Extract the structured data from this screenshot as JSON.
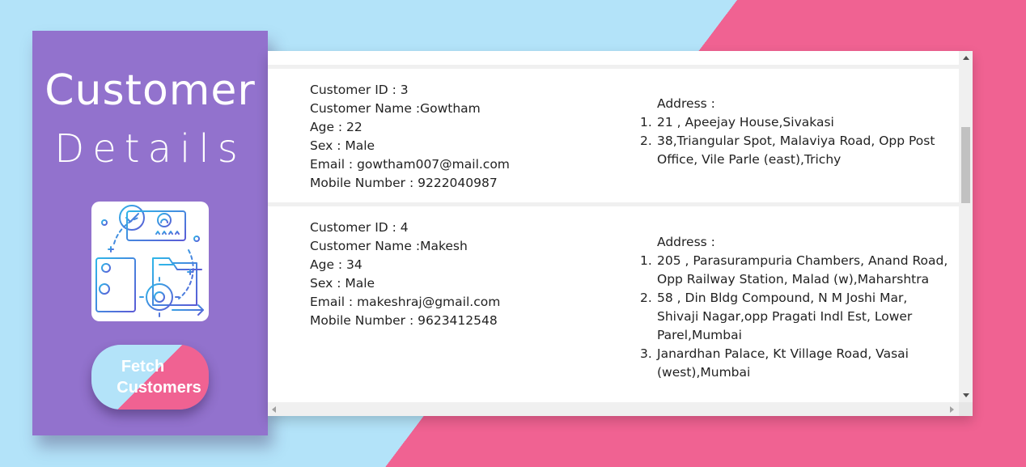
{
  "sidebar": {
    "title_line1": "Customer",
    "title_line2": "Details",
    "illustration_icon": "customer-profile-illustration-icon",
    "fetch_button_line1": "Fetch",
    "fetch_button_line2": "Customers"
  },
  "colors": {
    "sidebar_bg": "#9272cd",
    "background_blue": "#b3e3f9",
    "background_pink": "#f06292",
    "card_bg": "#ffffff",
    "panel_bg": "#f0f0f0"
  },
  "customers": [
    {
      "id_line": "Customer ID : 3",
      "name_line": "Customer Name :Gowtham",
      "age_line": "Age : 22",
      "sex_line": "Sex : Male",
      "email_line": "Email : gowtham007@mail.com",
      "mobile_line": "Mobile Number : 9222040987",
      "address_label": "Address :",
      "addresses": [
        {
          "num": "1.",
          "line1": "21 , Apeejay House,Sivakasi"
        },
        {
          "num": "2.",
          "line1": "38,Triangular Spot, Malaviya Road, Opp Post",
          "line2": "Office, Vile Parle (east),Trichy"
        }
      ]
    },
    {
      "id_line": "Customer ID : 4",
      "name_line": "Customer Name :Makesh",
      "age_line": "Age : 34",
      "sex_line": "Sex : Male",
      "email_line": "Email : makeshraj@gmail.com",
      "mobile_line": "Mobile Number : 9623412548",
      "address_label": "Address :",
      "addresses": [
        {
          "num": "1.",
          "line1": "205 , Parasurampuria Chambers, Anand Road,",
          "line2": "Opp Railway Station, Malad (w),Maharshtra"
        },
        {
          "num": "2.",
          "line1": "58 , Din Bldg Compound, N M Joshi Mar,",
          "line2": "Shivaji Nagar,opp Pragati Indl Est, Lower",
          "line3": "Parel,Mumbai"
        },
        {
          "num": "3.",
          "line1": "Janardhan Palace, Kt Village Road, Vasai",
          "line2": "(west),Mumbai"
        }
      ]
    }
  ]
}
